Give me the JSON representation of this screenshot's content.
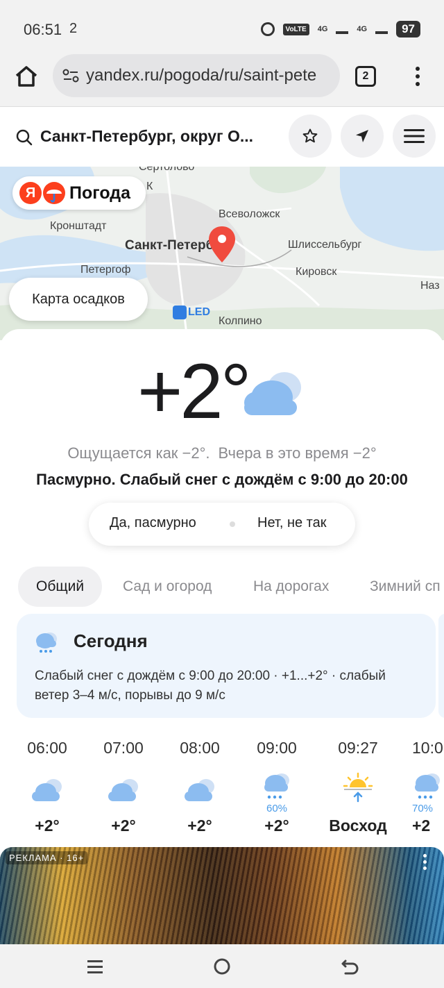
{
  "status_bar": {
    "time": "06:51",
    "small_indicator": "2",
    "volte": "VoLTE",
    "net1": "4G",
    "net2": "4G",
    "battery": "97"
  },
  "browser": {
    "url": "yandex.ru/pogoda/ru/saint-pete",
    "tab_count": "2"
  },
  "search": {
    "location": "Санкт-Петербург, округ О..."
  },
  "map": {
    "logo_ya": "Я",
    "logo_text": "Погода",
    "precip_button": "Карта осадков",
    "labels": {
      "sertolovo": "Сертолово",
      "kk": "К",
      "vsevolozhsk": "Всеволожск",
      "kronshtadt": "Кронштадт",
      "spb": "Санкт-Петербург",
      "shlisselburg": "Шлиссельбург",
      "peterhof": "Петергоф",
      "kirovsk": "Кировск",
      "naz": "Наз",
      "airport": "LED",
      "kolpino": "Колпино"
    }
  },
  "current": {
    "temperature": "+2°",
    "feels_like": "Ощущается как −2°.",
    "yesterday": "Вчера в это время −2°",
    "condition": "Пасмурно. Слабый снег с дождём с 9:00 до 20:00",
    "vote_yes": "Да, пасмурно",
    "vote_no": "Нет, не так"
  },
  "tabs": [
    "Общий",
    "Сад и огород",
    "На дорогах",
    "Зимний сп"
  ],
  "today": {
    "title": "Сегодня",
    "text": "Слабый снег с дождём с 9:00 до 20:00 · +1...+2° · слабый ветер 3–4 м/с, порывы до 9 м/с"
  },
  "hourly": [
    {
      "time": "06:00",
      "icon": "cloud-icon",
      "prob": "",
      "temp": "+2°"
    },
    {
      "time": "07:00",
      "icon": "cloud-icon",
      "prob": "",
      "temp": "+2°"
    },
    {
      "time": "08:00",
      "icon": "cloud-icon",
      "prob": "",
      "temp": "+2°"
    },
    {
      "time": "09:00",
      "icon": "sleet-icon",
      "prob": "60%",
      "temp": "+2°"
    },
    {
      "time": "09:27",
      "icon": "sunrise-icon",
      "prob": "",
      "temp": "Восход"
    },
    {
      "time": "10:0",
      "icon": "sleet-icon",
      "prob": "70%",
      "temp": "+2"
    }
  ],
  "ad": {
    "label": "РЕКЛАМА · 16+"
  },
  "colors": {
    "accent_red": "#fc3f1d",
    "cloud": "#8cbcf0",
    "today_bg": "#eef5fd",
    "prob_blue": "#4a9be8"
  }
}
